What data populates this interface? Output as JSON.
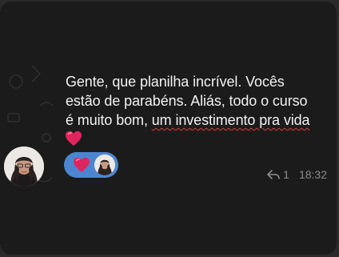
{
  "message": {
    "line1": "Gente, que planilha incrível. Vocês",
    "line2": "estão de parabéns. Aliás, todo o curso",
    "line3_prefix": "é muito bom, ",
    "line3_underlined": "um investimento pra vida",
    "emoji": "heart-emoji"
  },
  "reaction": {
    "icon": "heart-icon",
    "color": "#4c86d1"
  },
  "meta": {
    "reply_count": "1",
    "time": "18:32"
  }
}
